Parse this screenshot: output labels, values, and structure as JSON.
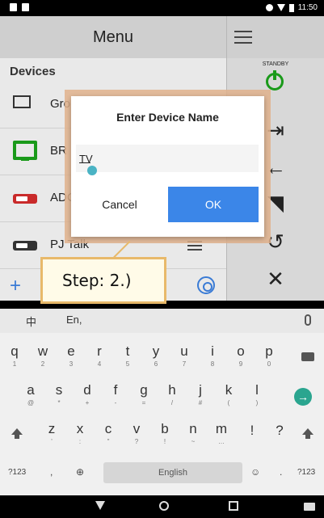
{
  "status_bar": {
    "time": "11:50"
  },
  "app": {
    "title": "Menu",
    "devices_heading": "Devices",
    "devices": [
      {
        "label": "Group"
      },
      {
        "label": "BR"
      },
      {
        "label": "ADC"
      },
      {
        "label": "PJ Talk"
      }
    ],
    "right_panel": {
      "standby_label": "STANDBY"
    }
  },
  "dialog": {
    "title": "Enter Device Name",
    "input_value": "TV",
    "cancel_label": "Cancel",
    "ok_label": "OK"
  },
  "callout": {
    "text": "Step: 2.)"
  },
  "keyboard": {
    "tab_chinese": "中",
    "tab_english": "En,",
    "row1": [
      {
        "k": "q",
        "s": "1"
      },
      {
        "k": "w",
        "s": "2"
      },
      {
        "k": "e",
        "s": "3"
      },
      {
        "k": "r",
        "s": "4"
      },
      {
        "k": "t",
        "s": "5"
      },
      {
        "k": "y",
        "s": "6"
      },
      {
        "k": "u",
        "s": "7"
      },
      {
        "k": "i",
        "s": "8"
      },
      {
        "k": "o",
        "s": "9"
      },
      {
        "k": "p",
        "s": "0"
      }
    ],
    "row2": [
      {
        "k": "a",
        "s": "@"
      },
      {
        "k": "s",
        "s": "*"
      },
      {
        "k": "d",
        "s": "+"
      },
      {
        "k": "f",
        "s": "-"
      },
      {
        "k": "g",
        "s": "="
      },
      {
        "k": "h",
        "s": "/"
      },
      {
        "k": "j",
        "s": "#"
      },
      {
        "k": "k",
        "s": "("
      },
      {
        "k": "l",
        "s": ")"
      }
    ],
    "row3": [
      {
        "k": "z",
        "s": "'"
      },
      {
        "k": "x",
        "s": ":"
      },
      {
        "k": "c",
        "s": "\""
      },
      {
        "k": "v",
        "s": "?"
      },
      {
        "k": "b",
        "s": "!"
      },
      {
        "k": "n",
        "s": "~"
      },
      {
        "k": "m",
        "s": "…"
      }
    ],
    "row3_extra": [
      "!",
      "?"
    ],
    "bottom": {
      "sym": "?123",
      "comma": ",",
      "space": "English",
      "period": ".",
      "sym_right": "?123"
    }
  }
}
